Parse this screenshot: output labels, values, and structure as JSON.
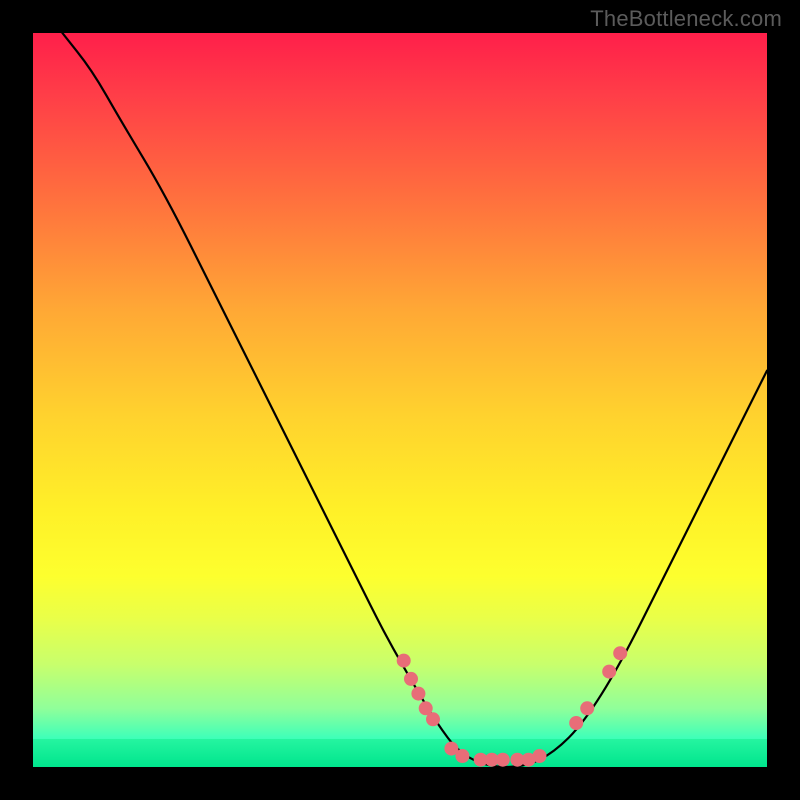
{
  "watermark": "TheBottleneck.com",
  "chart_data": {
    "type": "line",
    "title": "",
    "xlabel": "",
    "ylabel": "",
    "xlim": [
      0,
      100
    ],
    "ylim": [
      0,
      100
    ],
    "curve": [
      {
        "x": 4,
        "y": 100
      },
      {
        "x": 8,
        "y": 95
      },
      {
        "x": 12,
        "y": 88
      },
      {
        "x": 18,
        "y": 78
      },
      {
        "x": 25,
        "y": 64
      },
      {
        "x": 32,
        "y": 50
      },
      {
        "x": 38,
        "y": 38
      },
      {
        "x": 44,
        "y": 26
      },
      {
        "x": 48,
        "y": 18
      },
      {
        "x": 52,
        "y": 11
      },
      {
        "x": 55,
        "y": 6
      },
      {
        "x": 58,
        "y": 2
      },
      {
        "x": 62,
        "y": 0
      },
      {
        "x": 67,
        "y": 0
      },
      {
        "x": 71,
        "y": 2
      },
      {
        "x": 75,
        "y": 6
      },
      {
        "x": 80,
        "y": 14
      },
      {
        "x": 86,
        "y": 26
      },
      {
        "x": 92,
        "y": 38
      },
      {
        "x": 100,
        "y": 54
      }
    ],
    "markers": [
      {
        "x": 50.5,
        "y": 14.5
      },
      {
        "x": 51.5,
        "y": 12
      },
      {
        "x": 52.5,
        "y": 10
      },
      {
        "x": 53.5,
        "y": 8
      },
      {
        "x": 54.5,
        "y": 6.5
      },
      {
        "x": 57,
        "y": 2.5
      },
      {
        "x": 58.5,
        "y": 1.5
      },
      {
        "x": 61,
        "y": 1
      },
      {
        "x": 62.5,
        "y": 1
      },
      {
        "x": 64,
        "y": 1
      },
      {
        "x": 66,
        "y": 1
      },
      {
        "x": 67.5,
        "y": 1
      },
      {
        "x": 69,
        "y": 1.5
      },
      {
        "x": 74,
        "y": 6
      },
      {
        "x": 75.5,
        "y": 8
      },
      {
        "x": 78.5,
        "y": 13
      },
      {
        "x": 80,
        "y": 15.5
      }
    ],
    "marker_color": "#e86d78",
    "marker_radius_px": 7
  }
}
